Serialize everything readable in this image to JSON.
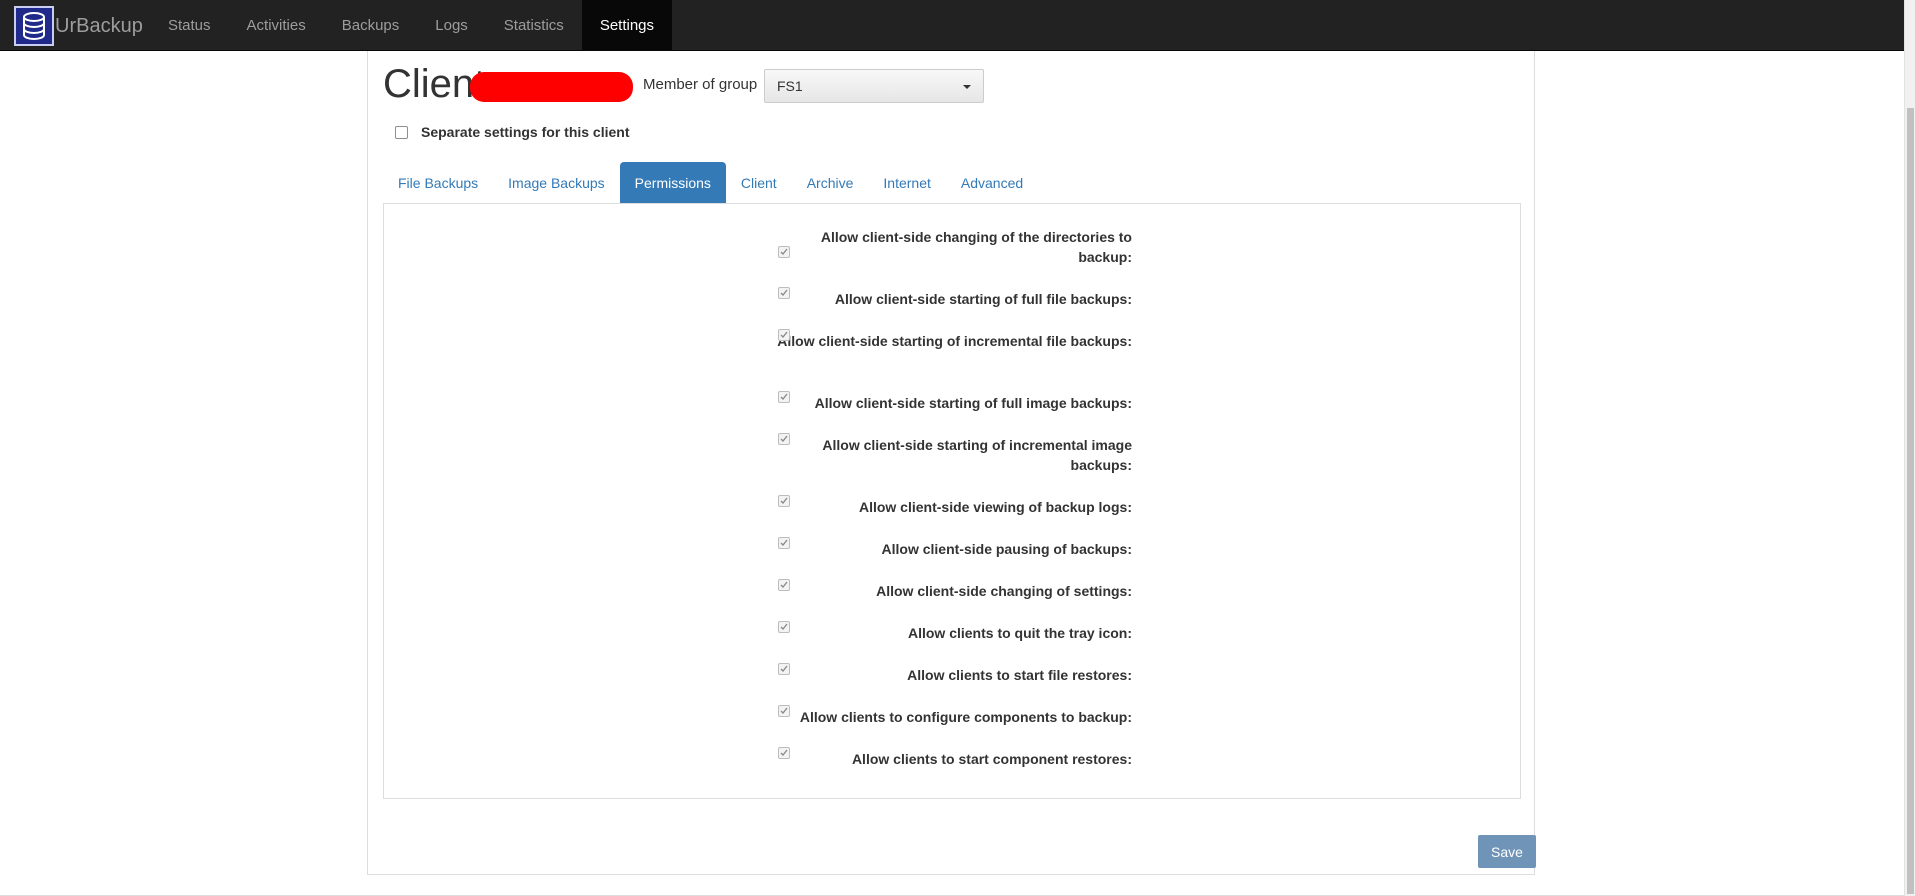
{
  "navbar": {
    "brand": "UrBackup",
    "items": [
      {
        "label": "Status",
        "active": false
      },
      {
        "label": "Activities",
        "active": false
      },
      {
        "label": "Backups",
        "active": false
      },
      {
        "label": "Logs",
        "active": false
      },
      {
        "label": "Statistics",
        "active": false
      },
      {
        "label": "Settings",
        "active": true
      }
    ]
  },
  "client": {
    "title": "Client",
    "group_label": "Member of group",
    "group_value": "FS1",
    "separate_settings_label": "Separate settings for this client"
  },
  "tabs": [
    {
      "label": "File Backups",
      "active": false
    },
    {
      "label": "Image Backups",
      "active": false
    },
    {
      "label": "Permissions",
      "active": true
    },
    {
      "label": "Client",
      "active": false
    },
    {
      "label": "Archive",
      "active": false
    },
    {
      "label": "Internet",
      "active": false
    },
    {
      "label": "Advanced",
      "active": false
    }
  ],
  "permissions": [
    {
      "label": "Allow client-side changing of the directories to backup:",
      "checked": true
    },
    {
      "label": "Allow client-side starting of full file backups:",
      "checked": true
    },
    {
      "label": "Allow client-side starting of incremental file backups:",
      "checked": true
    },
    {
      "label": "Allow client-side starting of full image backups:",
      "checked": true
    },
    {
      "label": "Allow client-side starting of incremental image backups:",
      "checked": true
    },
    {
      "label": "Allow client-side viewing of backup logs:",
      "checked": true
    },
    {
      "label": "Allow client-side pausing of backups:",
      "checked": true
    },
    {
      "label": "Allow client-side changing of settings:",
      "checked": true
    },
    {
      "label": "Allow clients to quit the tray icon:",
      "checked": true
    },
    {
      "label": "Allow clients to start file restores:",
      "checked": true
    },
    {
      "label": "Allow clients to configure components to backup:",
      "checked": true
    },
    {
      "label": "Allow clients to start component restores:",
      "checked": true
    }
  ],
  "save_label": "Save",
  "colors": {
    "navbar_bg": "#222222",
    "accent": "#337ab7",
    "save_bg": "#6f94b8"
  }
}
